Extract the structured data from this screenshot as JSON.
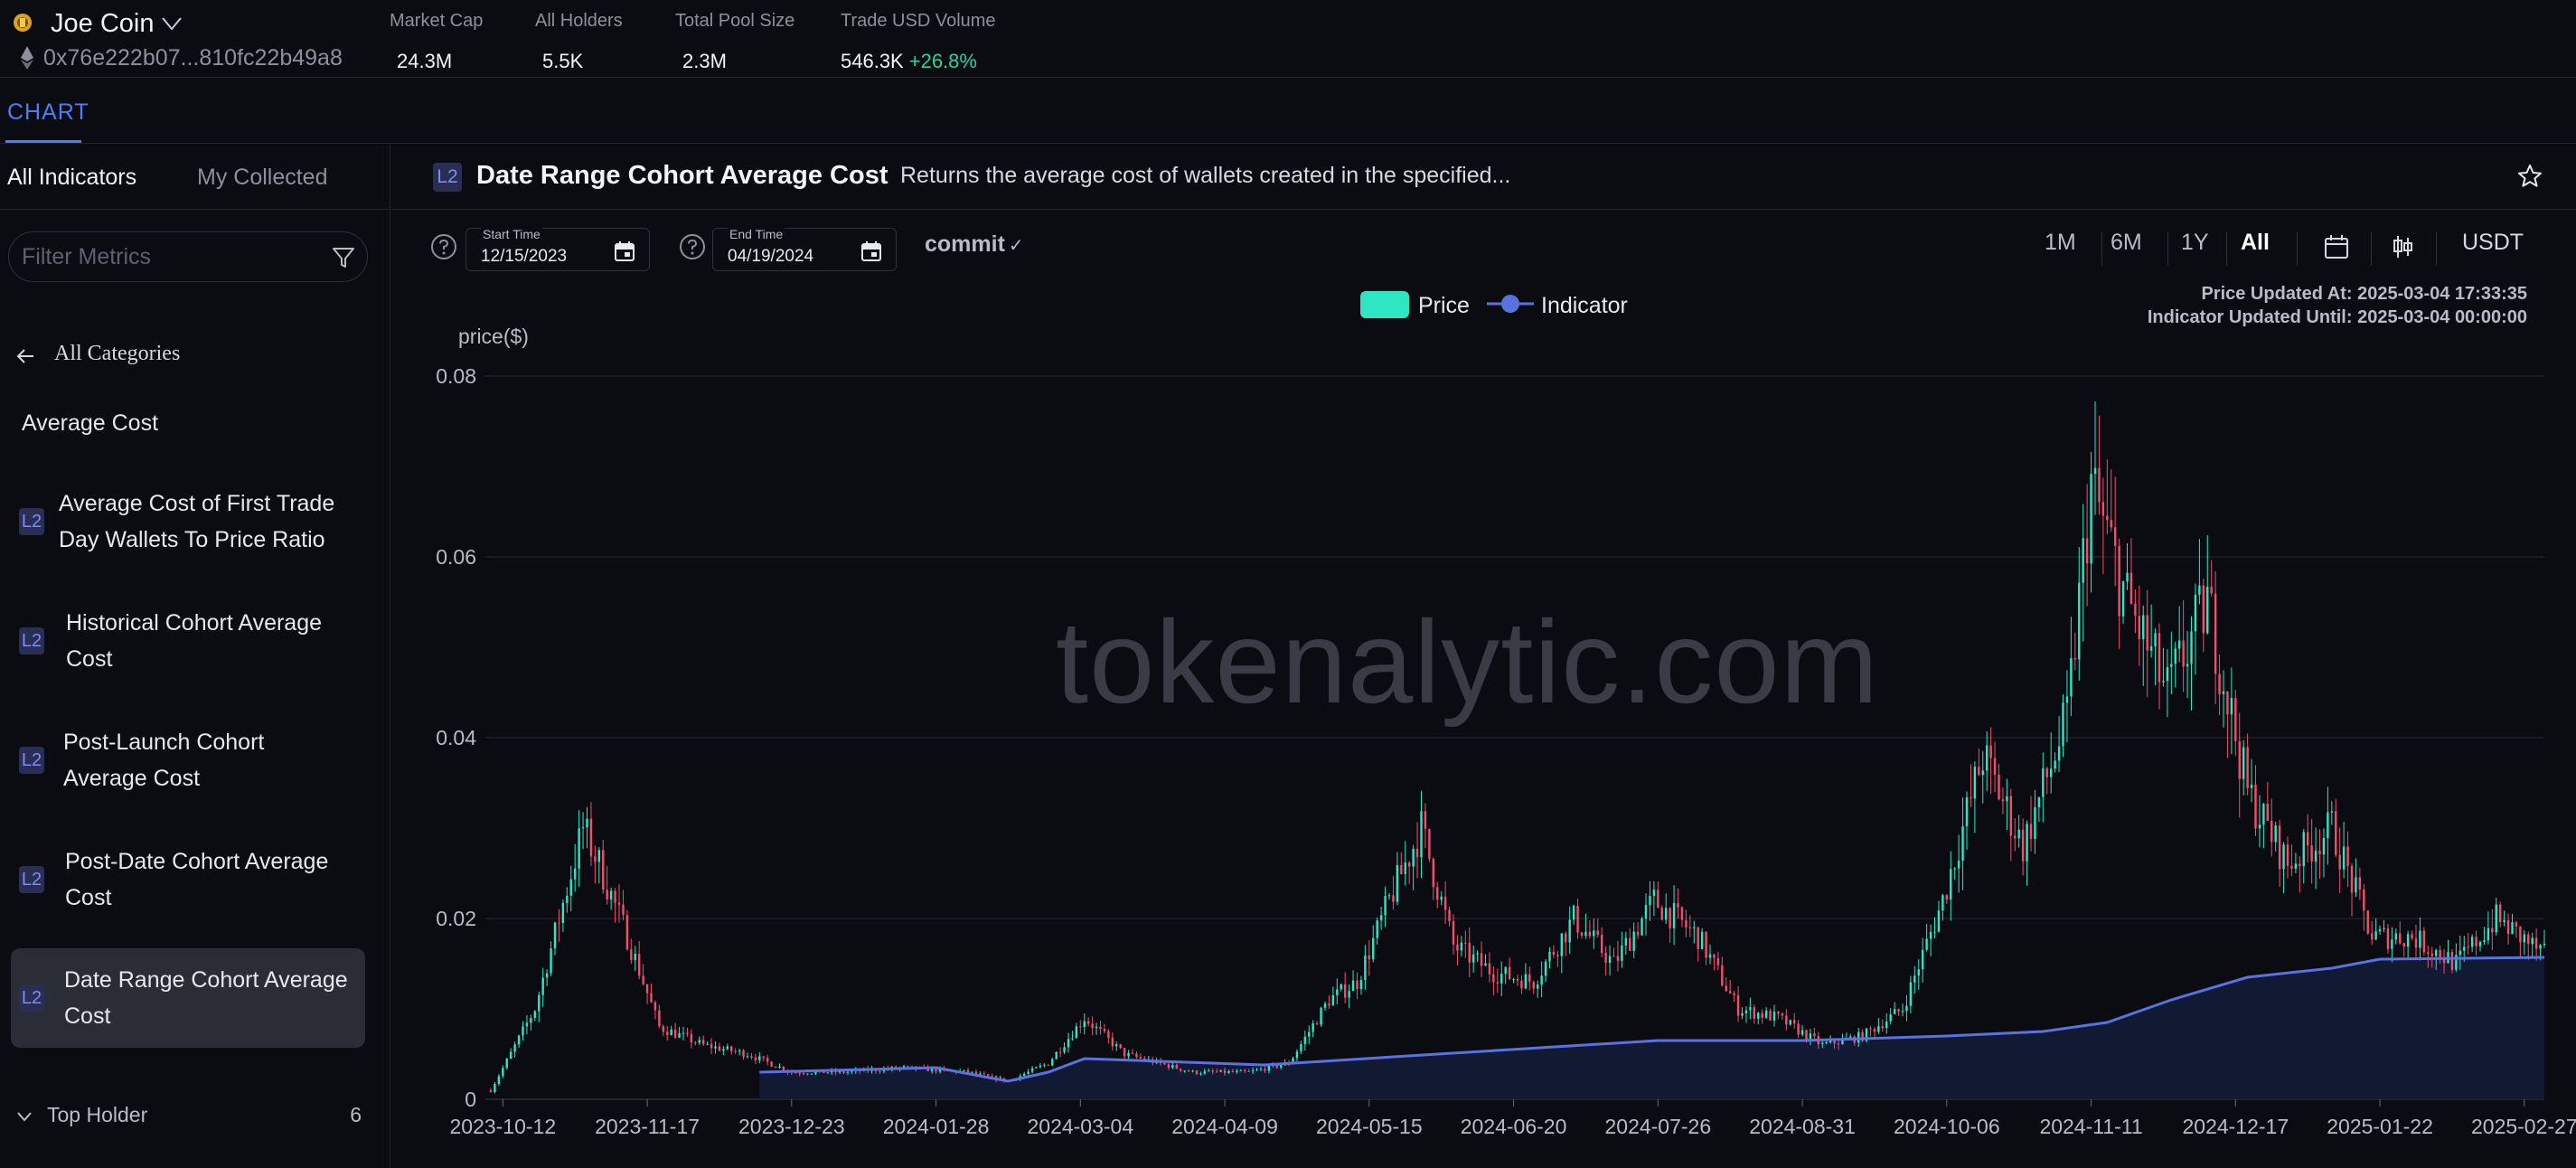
{
  "header": {
    "coin_name": "Joe Coin",
    "address": "0x76e222b07...810fc22b49a8",
    "stats": [
      {
        "label": "Market Cap",
        "value": "24.3M",
        "change": ""
      },
      {
        "label": "All Holders",
        "value": "5.5K",
        "change": ""
      },
      {
        "label": "Total Pool Size",
        "value": "2.3M",
        "change": ""
      },
      {
        "label": "Trade USD Volume",
        "value": "546.3K",
        "change": "+26.8%"
      }
    ]
  },
  "tabs": {
    "chart": "CHART"
  },
  "sidebar": {
    "tab_all": "All Indicators",
    "tab_collected": "My Collected",
    "filter_placeholder": "Filter Metrics",
    "back_label": "All Categories",
    "category_title": "Average Cost",
    "badge": "L2",
    "metrics": [
      {
        "line1": "Average Cost of First Trade",
        "line2": "Day Wallets To Price Ratio"
      },
      {
        "line1": "Historical Cohort Average",
        "line2": "Cost"
      },
      {
        "line1": "Post-Launch Cohort",
        "line2": "Average Cost"
      },
      {
        "line1": "Post-Date Cohort Average",
        "line2": "Cost"
      },
      {
        "line1": "Date Range Cohort Average",
        "line2": "Cost"
      }
    ],
    "top_holder_label": "Top Holder",
    "top_holder_count": "6"
  },
  "indicator": {
    "badge": "L2",
    "title": "Date Range Cohort Average Cost",
    "description": "Returns the average cost of wallets created in the specified..."
  },
  "controls": {
    "start_label": "Start Time",
    "start_value": "12/15/2023",
    "end_label": "End Time",
    "end_value": "04/19/2024",
    "commit": "commit",
    "ranges": [
      "1M",
      "6M",
      "1Y",
      "All"
    ],
    "active_range": "All",
    "currency": "USDT"
  },
  "legend": {
    "price": "Price",
    "indicator": "Indicator"
  },
  "updates": {
    "price": "Price Updated At: 2025-03-04 17:33:35",
    "indicator": "Indicator Updated Until: 2025-03-04 00:00:00"
  },
  "watermark": "tokenalytic.com",
  "colors": {
    "up": "#2ee6c4",
    "down": "#f0506e",
    "indicator": "#5a72e0",
    "indicator_fill": "#131a36",
    "accent": "#4c7cf7",
    "positive": "#2bd39a"
  },
  "chart_data": {
    "type": "line",
    "ylabel": "price($)",
    "ylim": [
      0,
      0.08
    ],
    "y_ticks": [
      0,
      0.02,
      0.04,
      0.06,
      0.08
    ],
    "y_tick_labels": [
      "0",
      "0.02",
      "0.04",
      "0.06",
      "0.08"
    ],
    "x_range": [
      "2023-10-09",
      "2025-03-04"
    ],
    "x_tick_labels": [
      "2023-10-12",
      "2023-11-17",
      "2023-12-23",
      "2024-01-28",
      "2024-03-04",
      "2024-04-09",
      "2024-05-15",
      "2024-06-20",
      "2024-07-26",
      "2024-08-31",
      "2024-10-06",
      "2024-11-11",
      "2024-12-17",
      "2025-01-22",
      "2025-02-27"
    ],
    "series": [
      {
        "name": "Price",
        "style": "candlestick",
        "x": [
          "2023-10-09",
          "2023-10-20",
          "2023-11-01",
          "2023-11-05",
          "2023-11-12",
          "2023-11-20",
          "2023-12-01",
          "2023-12-12",
          "2023-12-23",
          "2024-01-05",
          "2024-01-20",
          "2024-02-05",
          "2024-02-15",
          "2024-02-25",
          "2024-03-05",
          "2024-03-15",
          "2024-04-01",
          "2024-04-15",
          "2024-04-25",
          "2024-05-05",
          "2024-05-12",
          "2024-05-20",
          "2024-05-28",
          "2024-06-05",
          "2024-06-15",
          "2024-06-25",
          "2024-07-05",
          "2024-07-15",
          "2024-07-25",
          "2024-08-05",
          "2024-08-15",
          "2024-08-25",
          "2024-09-05",
          "2024-09-15",
          "2024-09-25",
          "2024-10-05",
          "2024-10-15",
          "2024-10-25",
          "2024-11-05",
          "2024-11-11",
          "2024-11-20",
          "2024-11-30",
          "2024-12-10",
          "2024-12-20",
          "2024-12-30",
          "2025-01-10",
          "2025-01-20",
          "2025-01-30",
          "2025-02-10",
          "2025-02-20",
          "2025-03-04"
        ],
        "values": [
          0.001,
          0.01,
          0.03,
          0.026,
          0.018,
          0.008,
          0.006,
          0.005,
          0.003,
          0.003,
          0.0035,
          0.003,
          0.002,
          0.004,
          0.009,
          0.005,
          0.003,
          0.003,
          0.004,
          0.011,
          0.013,
          0.022,
          0.03,
          0.017,
          0.014,
          0.013,
          0.02,
          0.015,
          0.022,
          0.018,
          0.01,
          0.009,
          0.006,
          0.007,
          0.01,
          0.022,
          0.038,
          0.028,
          0.042,
          0.068,
          0.055,
          0.045,
          0.055,
          0.034,
          0.026,
          0.03,
          0.018,
          0.018,
          0.015,
          0.02,
          0.016
        ]
      },
      {
        "name": "Indicator",
        "style": "line-area",
        "x": [
          "2023-12-15",
          "2024-01-28",
          "2024-02-15",
          "2024-02-25",
          "2024-03-05",
          "2024-04-19",
          "2024-06-01",
          "2024-07-26",
          "2024-08-31",
          "2024-10-06",
          "2024-10-30",
          "2024-11-15",
          "2024-12-01",
          "2024-12-20",
          "2025-01-10",
          "2025-01-22",
          "2025-03-04"
        ],
        "values": [
          0.003,
          0.0035,
          0.002,
          0.003,
          0.0045,
          0.0038,
          0.005,
          0.0065,
          0.0065,
          0.007,
          0.0075,
          0.0085,
          0.011,
          0.0135,
          0.0145,
          0.0155,
          0.0157
        ]
      }
    ]
  }
}
